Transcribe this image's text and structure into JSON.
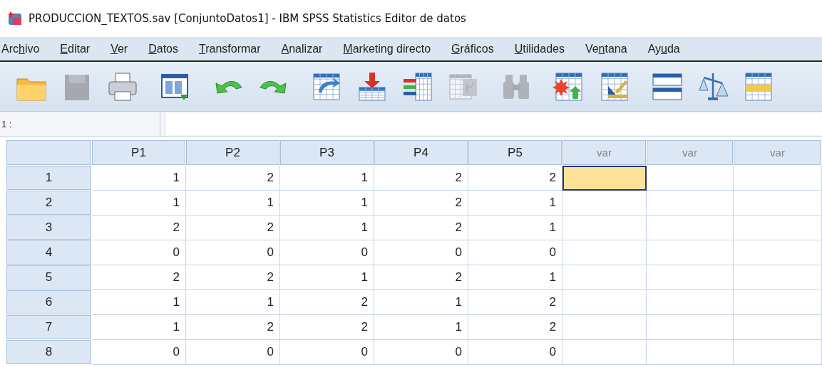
{
  "window": {
    "title": "PRODUCCION_TEXTOS.sav [ConjuntoDatos1] - IBM SPSS Statistics Editor de datos"
  },
  "menu": [
    {
      "before": "Arc",
      "key": "h",
      "after": "ivo"
    },
    {
      "key": "E",
      "after": "ditar"
    },
    {
      "key": "V",
      "after": "er"
    },
    {
      "key": "D",
      "after": "atos"
    },
    {
      "key": "T",
      "after": "ransformar"
    },
    {
      "key": "A",
      "after": "nalizar"
    },
    {
      "key": "M",
      "after": "arketing directo"
    },
    {
      "key": "G",
      "after": "ráficos"
    },
    {
      "key": "U",
      "after": "tilidades"
    },
    {
      "before": "Ve",
      "key": "n",
      "after": "tana"
    },
    {
      "before": "Ay",
      "key": "u",
      "after": "da"
    }
  ],
  "toolbar": [
    {
      "disabled": false
    },
    {
      "disabled": true
    },
    {
      "disabled": false
    },
    {
      "disabled": false
    },
    {
      "disabled": false
    },
    {
      "disabled": false
    },
    {
      "disabled": false
    },
    {
      "disabled": false
    },
    {
      "disabled": false
    },
    {
      "disabled": true
    },
    {
      "disabled": true
    },
    {
      "disabled": false
    },
    {
      "disabled": false
    },
    {
      "disabled": false
    },
    {
      "disabled": false
    },
    {
      "disabled": false
    }
  ],
  "cell_reference": {
    "label": "1 :"
  },
  "table": {
    "columns": [
      {
        "label": "P1",
        "kind": "variable"
      },
      {
        "label": "P2",
        "kind": "variable"
      },
      {
        "label": "P3",
        "kind": "variable"
      },
      {
        "label": "P4",
        "kind": "variable"
      },
      {
        "label": "P5",
        "kind": "variable"
      },
      {
        "label": "var",
        "kind": "empty"
      },
      {
        "label": "var",
        "kind": "empty"
      },
      {
        "label": "var",
        "kind": "empty"
      }
    ],
    "rows": [
      {
        "label": "1",
        "cells": [
          {
            "value": "1",
            "selected": false
          },
          {
            "value": "2",
            "selected": false
          },
          {
            "value": "1",
            "selected": false
          },
          {
            "value": "2",
            "selected": false
          },
          {
            "value": "2",
            "selected": false
          },
          {
            "selected": true
          },
          {
            "selected": false
          },
          {
            "selected": false
          }
        ]
      },
      {
        "label": "2",
        "cells": [
          {
            "value": "1",
            "selected": false
          },
          {
            "value": "1",
            "selected": false
          },
          {
            "value": "1",
            "selected": false
          },
          {
            "value": "2",
            "selected": false
          },
          {
            "value": "1",
            "selected": false
          },
          {
            "selected": false
          },
          {
            "selected": false
          },
          {
            "selected": false
          }
        ]
      },
      {
        "label": "3",
        "cells": [
          {
            "value": "2",
            "selected": false
          },
          {
            "value": "2",
            "selected": false
          },
          {
            "value": "1",
            "selected": false
          },
          {
            "value": "2",
            "selected": false
          },
          {
            "value": "1",
            "selected": false
          },
          {
            "selected": false
          },
          {
            "selected": false
          },
          {
            "selected": false
          }
        ]
      },
      {
        "label": "4",
        "cells": [
          {
            "value": "0",
            "selected": false
          },
          {
            "value": "0",
            "selected": false
          },
          {
            "value": "0",
            "selected": false
          },
          {
            "value": "0",
            "selected": false
          },
          {
            "value": "0",
            "selected": false
          },
          {
            "selected": false
          },
          {
            "selected": false
          },
          {
            "selected": false
          }
        ]
      },
      {
        "label": "5",
        "cells": [
          {
            "value": "2",
            "selected": false
          },
          {
            "value": "2",
            "selected": false
          },
          {
            "value": "1",
            "selected": false
          },
          {
            "value": "2",
            "selected": false
          },
          {
            "value": "1",
            "selected": false
          },
          {
            "selected": false
          },
          {
            "selected": false
          },
          {
            "selected": false
          }
        ]
      },
      {
        "label": "6",
        "cells": [
          {
            "value": "1",
            "selected": false
          },
          {
            "value": "1",
            "selected": false
          },
          {
            "value": "2",
            "selected": false
          },
          {
            "value": "1",
            "selected": false
          },
          {
            "value": "2",
            "selected": false
          },
          {
            "selected": false
          },
          {
            "selected": false
          },
          {
            "selected": false
          }
        ]
      },
      {
        "label": "7",
        "cells": [
          {
            "value": "1",
            "selected": false
          },
          {
            "value": "2",
            "selected": false
          },
          {
            "value": "2",
            "selected": false
          },
          {
            "value": "1",
            "selected": false
          },
          {
            "value": "2",
            "selected": false
          },
          {
            "selected": false
          },
          {
            "selected": false
          },
          {
            "selected": false
          }
        ]
      },
      {
        "label": "8",
        "cells": [
          {
            "value": "0",
            "selected": false
          },
          {
            "value": "0",
            "selected": false
          },
          {
            "value": "0",
            "selected": false
          },
          {
            "value": "0",
            "selected": false
          },
          {
            "value": "0",
            "selected": false
          },
          {
            "selected": false
          },
          {
            "selected": false
          },
          {
            "selected": false
          }
        ]
      }
    ]
  }
}
